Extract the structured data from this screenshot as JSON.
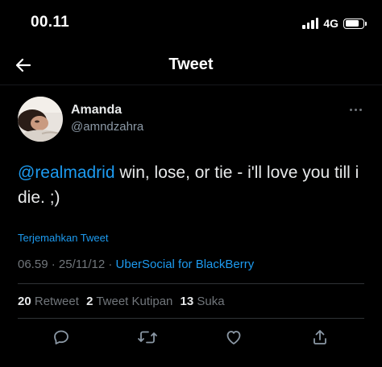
{
  "status_bar": {
    "time": "00.11",
    "network": "4G",
    "battery_level": 0.8
  },
  "header": {
    "title": "Tweet",
    "back_icon": "arrow-left-icon"
  },
  "tweet": {
    "display_name": "Amanda",
    "username": "@amndzahra",
    "mention": "@realmadrid",
    "text": " win, lose, or tie - i'll love you till i die. ;)",
    "translate_label": "Terjemahkan Tweet",
    "time": "06.59",
    "separator": " · ",
    "date": "25/11/12",
    "source": "UberSocial for BlackBerry"
  },
  "stats": {
    "retweets_count": "20",
    "retweets_label": "Retweet",
    "quotes_count": "2",
    "quotes_label": "Tweet Kutipan",
    "likes_count": "13",
    "likes_label": "Suka"
  },
  "actions": [
    "reply-icon",
    "retweet-icon",
    "like-icon",
    "share-icon"
  ],
  "colors": {
    "accent": "#1d9bf0",
    "background": "#000000",
    "secondary_text": "#71767b"
  }
}
